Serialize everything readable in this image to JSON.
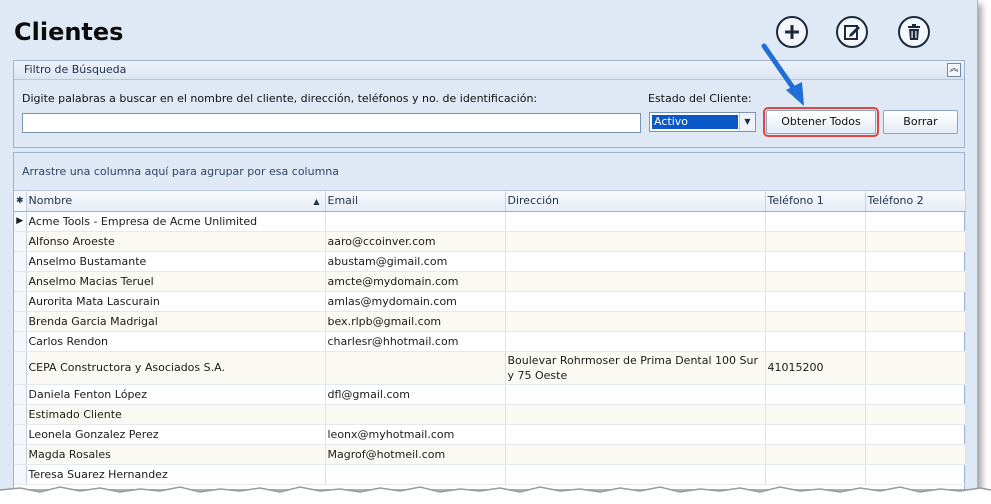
{
  "header": {
    "title": "Clientes"
  },
  "toolbar": {
    "add_icon": "plus-circle-icon",
    "edit_icon": "edit-icon",
    "delete_icon": "trash-icon"
  },
  "filter": {
    "title": "Filtro de Búsqueda",
    "search_label": "Digite palabras a buscar en el nombre del cliente, dirección, teléfonos y no. de identificación:",
    "search_value": "",
    "status_label": "Estado del Cliente:",
    "status_value": "Activo",
    "get_all_label": "Obtener Todos",
    "clear_label": "Borrar"
  },
  "grid": {
    "group_hint": "Arrastre una columna aquí para agrupar por esa columna",
    "columns": [
      "Nombre",
      "Email",
      "Dirección",
      "Teléfono 1",
      "Teléfono 2"
    ],
    "rows": [
      {
        "name": "Acme Tools - Empresa de Acme Unlimited",
        "email": "",
        "address": "",
        "phone1": "",
        "phone2": ""
      },
      {
        "name": "Alfonso Aroeste",
        "email": "aaro@ccoinver.com",
        "address": "",
        "phone1": "",
        "phone2": ""
      },
      {
        "name": "Anselmo Bustamante",
        "email": "abustam@gimail.com",
        "address": "",
        "phone1": "",
        "phone2": ""
      },
      {
        "name": "Anselmo Macias Teruel",
        "email": "amcte@mydomain.com",
        "address": "",
        "phone1": "",
        "phone2": ""
      },
      {
        "name": "Aurorita Mata Lascurain",
        "email": "amlas@mydomain.com",
        "address": "",
        "phone1": "",
        "phone2": ""
      },
      {
        "name": "Brenda Garcia Madrigal",
        "email": "bex.rlpb@gmail.com",
        "address": "",
        "phone1": "",
        "phone2": ""
      },
      {
        "name": "Carlos Rendon",
        "email": "charlesr@hhotmail.com",
        "address": "",
        "phone1": "",
        "phone2": ""
      },
      {
        "name": "CEPA Constructora y Asociados S.A.",
        "email": "",
        "address": "Boulevar Rohrmoser de Prima Dental 100 Sur y 75 Oeste",
        "phone1": "41015200",
        "phone2": ""
      },
      {
        "name": "Daniela Fenton López",
        "email": "dfl@gmail.com",
        "address": "",
        "phone1": "",
        "phone2": ""
      },
      {
        "name": "Estimado Cliente",
        "email": "",
        "address": "",
        "phone1": "",
        "phone2": ""
      },
      {
        "name": "Leonela Gonzalez Perez",
        "email": "leonx@myhotmail.com",
        "address": "",
        "phone1": "",
        "phone2": ""
      },
      {
        "name": "Magda Rosales",
        "email": "Magrof@hotmeil.com",
        "address": "",
        "phone1": "",
        "phone2": ""
      },
      {
        "name": "Teresa Suarez Hernandez",
        "email": "",
        "address": "",
        "phone1": "",
        "phone2": ""
      }
    ]
  },
  "colors": {
    "highlight": "#e0463b",
    "arrow": "#1f6fd6",
    "selection": "#0a57c8"
  }
}
